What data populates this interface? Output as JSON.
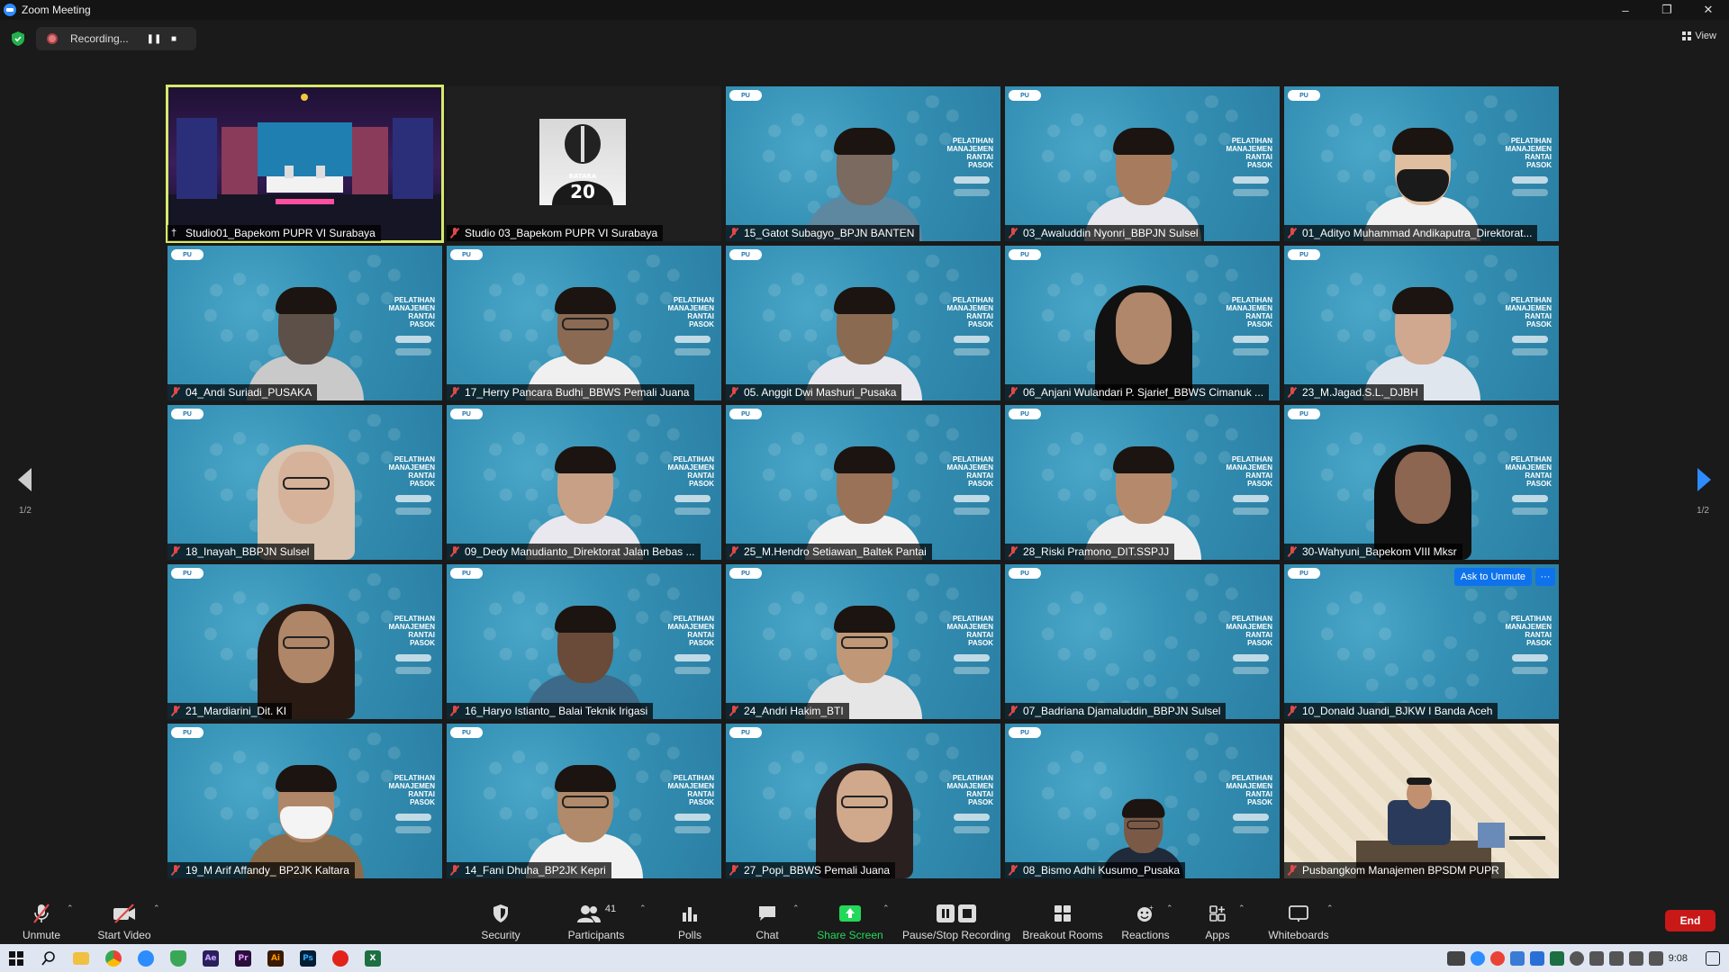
{
  "window": {
    "title": "Zoom Meeting"
  },
  "recording": {
    "label": "Recording..."
  },
  "view": {
    "label": "View"
  },
  "pagination": {
    "left": "1/2",
    "right": "1/2"
  },
  "tiles": [
    {
      "name": "Studio01_Bapekom PUPR VI Surabaya",
      "kind": "studio",
      "pinned": true,
      "active": true
    },
    {
      "name": "Studio 03_Bapekom PUPR VI Surabaya",
      "kind": "avatar",
      "avatar_text": "BATARA 20"
    },
    {
      "name": "15_Gatot Subagyo_BPJN BANTEN",
      "kind": "blue",
      "skin": "#7a6a60",
      "shirt": "#5e87a0"
    },
    {
      "name": "03_Awaluddin Nyonri_BBPJN Sulsel",
      "kind": "blue",
      "skin": "#a77c5e",
      "shirt": "#e8e8ee"
    },
    {
      "name": "01_Adityo Muhammad Andikaputra_Direktorat...",
      "kind": "blue",
      "skin": "#e0bfa0",
      "shirt": "#f2f2f2",
      "mask": "#1a1a1a"
    },
    {
      "name": "04_Andi Suriadi_PUSAKA",
      "kind": "blue",
      "skin": "#5d5049",
      "shirt": "#c9c9c9"
    },
    {
      "name": "17_Herry Pancara Budhi_BBWS Pemali Juana",
      "kind": "blue",
      "skin": "#8a6a52",
      "shirt": "#f0f0f0",
      "glasses": true
    },
    {
      "name": "05. Anggit Dwi Mashuri_Pusaka",
      "kind": "blue",
      "skin": "#8b6a52",
      "shirt": "#e8e8ee"
    },
    {
      "name": "06_Anjani Wulandari P. Sjarief_BBWS Cimanuk ...",
      "kind": "blue",
      "skin": "#b0876a",
      "hijab": "#111111"
    },
    {
      "name": "23_M.Jagad.S.L._DJBH",
      "kind": "blue",
      "skin": "#d0a890",
      "shirt": "#e0e6ee"
    },
    {
      "name": "18_Inayah_BBPJN Sulsel",
      "kind": "blue",
      "skin": "#d6b29a",
      "hijab": "#d8c4b0",
      "glasses": true
    },
    {
      "name": "09_Dedy Manudianto_Direktorat Jalan Bebas ...",
      "kind": "blue",
      "skin": "#c8a085",
      "shirt": "#e8e8ee"
    },
    {
      "name": "25_M.Hendro Setiawan_Baltek Pantai",
      "kind": "blue",
      "skin": "#9a7258",
      "shirt": "#f2f2f2"
    },
    {
      "name": "28_Riski Pramono_DIT.SSPJJ",
      "kind": "blue",
      "skin": "#b58a6c",
      "shirt": "#f0f0f0"
    },
    {
      "name": "30-Wahyuni_Bapekom VIII Mksr",
      "kind": "blue",
      "skin": "#8c6650",
      "hijab": "#111111"
    },
    {
      "name": "21_Mardiarini_Dit. KI",
      "kind": "blue",
      "skin": "#b08668",
      "hijab": "#2a1a14",
      "glasses": true
    },
    {
      "name": "16_Haryo Istianto_ Balai Teknik Irigasi",
      "kind": "blue",
      "skin": "#6a4a38",
      "shirt": "#3c6a88"
    },
    {
      "name": "24_Andri Hakim_BTI",
      "kind": "blue",
      "skin": "#c09878",
      "shirt": "#e6e6e6",
      "glasses": true
    },
    {
      "name": "07_Badriana Djamaluddin_BBPJN Sulsel",
      "kind": "blue-empty"
    },
    {
      "name": "10_Donald Juandi_BJKW I Banda Aceh",
      "kind": "blue-empty",
      "ask_unmute": "Ask to Unmute",
      "more": "···"
    },
    {
      "name": "19_M Arif Affandy_ BP2JK Kaltara",
      "kind": "blue",
      "skin": "#b08668",
      "shirt": "#8a6a48",
      "mask": "#f4f4f4"
    },
    {
      "name": "14_Fani Dhuha_BP2JK Kepri",
      "kind": "blue",
      "skin": "#b08a6a",
      "shirt": "#f2f2f2",
      "glasses": true
    },
    {
      "name": "27_Popi_BBWS Pemali Juana",
      "kind": "blue",
      "skin": "#d0a88c",
      "hijab": "#2a2020",
      "glasses": true
    },
    {
      "name": "08_Bismo Adhi Kusumo_Pusaka",
      "kind": "blue",
      "skin": "#7a5a46",
      "shirt": "#1f2a3a",
      "glasses": true,
      "small": true
    },
    {
      "name": "Pusbangkom Manajemen BPSDM PUPR",
      "kind": "room"
    }
  ],
  "banner": {
    "line1": "PELATIHAN",
    "line2": "MANAJEMEN",
    "line3": "RANTAI PASOK",
    "logo": "PU"
  },
  "toolbar": {
    "unmute": "Unmute",
    "start_video": "Start Video",
    "security": "Security",
    "participants": "Participants",
    "participants_count": "41",
    "polls": "Polls",
    "chat": "Chat",
    "share_screen": "Share Screen",
    "pause_stop_recording": "Pause/Stop Recording",
    "breakout_rooms": "Breakout Rooms",
    "reactions": "Reactions",
    "apps": "Apps",
    "whiteboards": "Whiteboards",
    "end": "End"
  },
  "taskbar": {
    "time": "9:08"
  },
  "colors": {
    "accent": "#2d8cff",
    "end": "#c91818",
    "active_outline": "#d6e96a",
    "share_green": "#23d959"
  }
}
